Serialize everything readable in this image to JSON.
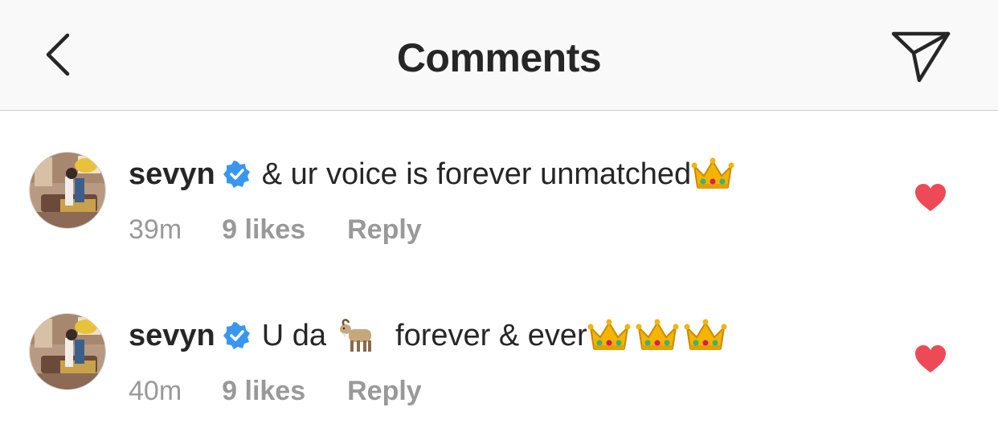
{
  "header": {
    "title": "Comments",
    "back_icon": "chevron-left-icon",
    "send_icon": "paper-plane-icon"
  },
  "colors": {
    "verified": "#3897f0",
    "heart": "#ed4956",
    "meta_text": "#999999",
    "primary_text": "#262626"
  },
  "comments": [
    {
      "username": "sevyn",
      "verified": true,
      "text": "& ur voice is forever unmatched",
      "emojis": [
        "crown"
      ],
      "time": "39m",
      "likes": "9 likes",
      "reply": "Reply",
      "liked": true
    },
    {
      "username": "sevyn",
      "verified": true,
      "text_before": "U da",
      "emoji_mid": "goat",
      "text_after": "forever & ever",
      "emojis": [
        "crown",
        "crown",
        "crown"
      ],
      "time": "40m",
      "likes": "9 likes",
      "reply": "Reply",
      "liked": true
    }
  ]
}
